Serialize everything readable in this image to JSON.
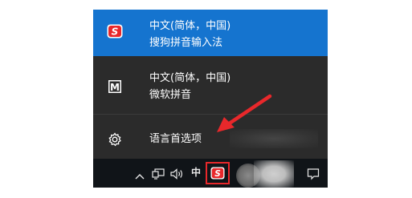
{
  "language_menu": {
    "items": [
      {
        "line1": "中文(简体，中国)",
        "line2": "搜狗拼音输入法",
        "icon": "sogou-icon",
        "selected": true
      },
      {
        "line1": "中文(简体，中国)",
        "line2": "微软拼音",
        "icon": "microsoft-ime-icon",
        "selected": false
      }
    ],
    "preferences_label": "语言首选项",
    "preferences_icon": "gear-icon"
  },
  "taskbar": {
    "input_mode_indicator": "中",
    "icons": [
      "chevron-up-icon",
      "network-icon",
      "volume-icon",
      "sogou-tray-icon",
      "notification-icon"
    ]
  },
  "colors": {
    "menu_bg": "#2b2b2b",
    "selected_bg": "#1574cf",
    "taskbar_bg": "#101418",
    "sogou_red": "#e8282b",
    "highlight_box": "#e8282b",
    "annotation_arrow": "#e8282b"
  }
}
